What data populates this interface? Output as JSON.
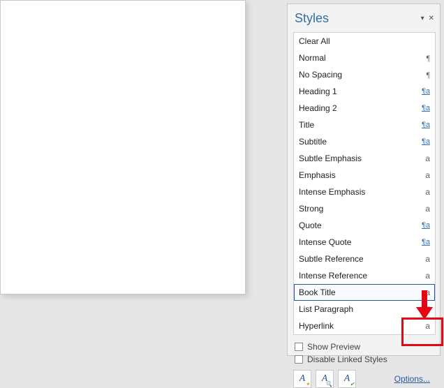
{
  "pane": {
    "title": "Styles",
    "menu_glyph": "▾",
    "close_glyph": "✕"
  },
  "styles": [
    {
      "name": "Clear All",
      "mark": "",
      "markClass": "",
      "selected": false
    },
    {
      "name": "Normal",
      "mark": "¶",
      "markClass": "pilcrow",
      "selected": false
    },
    {
      "name": "No Spacing",
      "mark": "¶",
      "markClass": "pilcrow",
      "selected": false
    },
    {
      "name": "Heading 1",
      "mark": "¶a",
      "markClass": "link",
      "selected": false
    },
    {
      "name": "Heading 2",
      "mark": "¶a",
      "markClass": "link",
      "selected": false
    },
    {
      "name": "Title",
      "mark": "¶a",
      "markClass": "link",
      "selected": false
    },
    {
      "name": "Subtitle",
      "mark": "¶a",
      "markClass": "link",
      "selected": false
    },
    {
      "name": "Subtle Emphasis",
      "mark": "a",
      "markClass": "",
      "selected": false
    },
    {
      "name": "Emphasis",
      "mark": "a",
      "markClass": "",
      "selected": false
    },
    {
      "name": "Intense Emphasis",
      "mark": "a",
      "markClass": "",
      "selected": false
    },
    {
      "name": "Strong",
      "mark": "a",
      "markClass": "",
      "selected": false
    },
    {
      "name": "Quote",
      "mark": "¶a",
      "markClass": "link",
      "selected": false
    },
    {
      "name": "Intense Quote",
      "mark": "¶a",
      "markClass": "link",
      "selected": false
    },
    {
      "name": "Subtle Reference",
      "mark": "a",
      "markClass": "",
      "selected": false
    },
    {
      "name": "Intense Reference",
      "mark": "a",
      "markClass": "",
      "selected": false
    },
    {
      "name": "Book Title",
      "mark": "a",
      "markClass": "",
      "selected": true
    },
    {
      "name": "List Paragraph",
      "mark": "¶",
      "markClass": "pilcrow",
      "selected": false
    },
    {
      "name": "Hyperlink",
      "mark": "a",
      "markClass": "",
      "selected": false
    }
  ],
  "checkboxes": {
    "show_preview": "Show Preview",
    "disable_linked": "Disable Linked Styles"
  },
  "footer": {
    "options": "Options..."
  }
}
